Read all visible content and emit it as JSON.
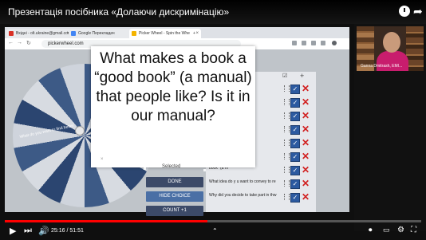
{
  "video": {
    "title": "Презентація посібника «Долаючи дискримінацію»",
    "current_time": "25:16",
    "duration": "51:51",
    "progress": 0.487
  },
  "browser": {
    "tabs": [
      {
        "label": "Вхідні - olt.ukraine@gmail.com",
        "icon_color": "#d93025"
      },
      {
        "label": "Google Перекладач",
        "icon_color": "#4285f4"
      },
      {
        "label": "Picker Wheel - Spin the Whe",
        "icon_color": "#f4b400"
      }
    ],
    "url": "pickerwheel.com"
  },
  "wheel": {
    "segment_label": "What do you want to find better"
  },
  "card": {
    "question": "What makes a book a “good book” (a manual) that people like? Is it in our manual?",
    "selected_label": "Selected",
    "close_label": "×"
  },
  "buttons": {
    "done": "DONE",
    "hide_choice": "HIDE CHOICE",
    "count": "COUNT +1"
  },
  "entries": [
    {
      "text": "the fields\" or",
      "checked": true
    },
    {
      "text": "esson to you po",
      "checked": true
    },
    {
      "text": "to find better",
      "checked": true
    },
    {
      "text": "matter the",
      "checked": true
    },
    {
      "text": "articular fi",
      "checked": true
    },
    {
      "text": "Nm the authi",
      "checked": true
    },
    {
      "text": "book\" (a m",
      "checked": true
    },
    {
      "text": "What idea do y  u want to convey to re",
      "checked": true
    },
    {
      "text": "Why did you decide to take part in thw",
      "checked": true
    }
  ],
  "participant": {
    "name": "Ganna Dmitrash, EMI..."
  },
  "icons": {
    "play": "play-icon",
    "next": "next-icon",
    "volume": "volume-icon",
    "clock": "watch-later-icon",
    "share": "share-icon",
    "settings": "gear-icon",
    "fullscreen": "fullscreen-icon"
  },
  "colors": {
    "progress": "#ff0000",
    "wheel_dark": "#2b4570",
    "check": "#2c5aa0",
    "delete": "#d12020"
  }
}
